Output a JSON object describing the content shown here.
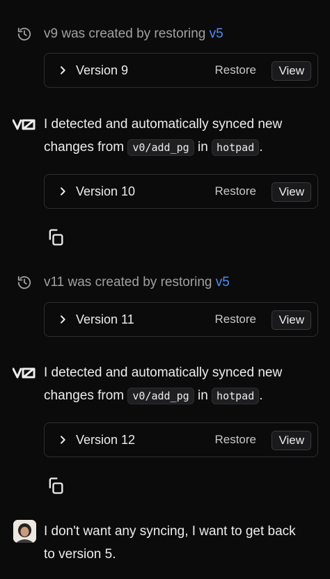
{
  "feed": {
    "item1": {
      "prefix": "v9 was created by restoring",
      "link": "v5",
      "card": {
        "label": "Version 9",
        "restore": "Restore",
        "view": "View"
      }
    },
    "item2": {
      "line1": "I detected and automatically synced new",
      "line2_pre": "changes from",
      "branch": "v0/add_pg",
      "in": "in",
      "repo": "hotpad",
      "end": ".",
      "card": {
        "label": "Version 10",
        "restore": "Restore",
        "view": "View"
      }
    },
    "item3": {
      "prefix": "v11 was created by restoring",
      "link": "v5",
      "card": {
        "label": "Version 11",
        "restore": "Restore",
        "view": "View"
      }
    },
    "item4": {
      "line1": "I detected and automatically synced new",
      "line2_pre": "changes from",
      "branch": "v0/add_pg",
      "in": "in",
      "repo": "hotpad",
      "end": ".",
      "card": {
        "label": "Version 12",
        "restore": "Restore",
        "view": "View"
      }
    },
    "user_message": {
      "line1": "I don't want any syncing, I want to get back",
      "line2": "to version 5."
    }
  },
  "icons": {
    "history": "history-icon",
    "v0_logo": "v0-logo",
    "copy": "copy-icon",
    "chevron": "chevron-right-icon"
  },
  "colors": {
    "background": "#0b0b0c",
    "text": "#ededed",
    "muted": "#a1a1a1",
    "link": "#4e8df5",
    "border": "#2e2e31"
  }
}
